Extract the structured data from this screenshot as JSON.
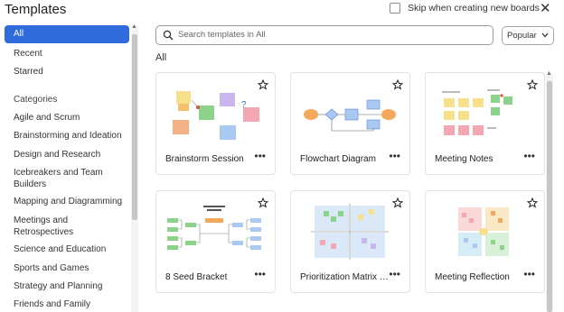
{
  "window": {
    "title": "Templates",
    "skip_label": "Skip when creating new boards"
  },
  "sidebar": {
    "items": [
      {
        "label": "All",
        "active": true
      },
      {
        "label": "Recent"
      },
      {
        "label": "Starred"
      }
    ],
    "categories_heading": "Categories",
    "categories": [
      "Agile and Scrum",
      "Brainstorming and Ideation",
      "Design and Research",
      "Icebreakers and Team Builders",
      "Mapping and Diagramming",
      "Meetings and Retrospectives",
      "Science and Education",
      "Sports and Games",
      "Strategy and Planning",
      "Friends and Family"
    ]
  },
  "search": {
    "placeholder": "Search templates in All"
  },
  "sort": {
    "selected": "Popular"
  },
  "main": {
    "heading": "All"
  },
  "templates": [
    {
      "name": "Brainstorm Session"
    },
    {
      "name": "Flowchart Diagram"
    },
    {
      "name": "Meeting Notes"
    },
    {
      "name": "8 Seed Bracket"
    },
    {
      "name": "Prioritization Matrix V..."
    },
    {
      "name": "Meeting Reflection"
    }
  ],
  "more_label": "•••",
  "colors": {
    "accent": "#2f6bdb"
  }
}
